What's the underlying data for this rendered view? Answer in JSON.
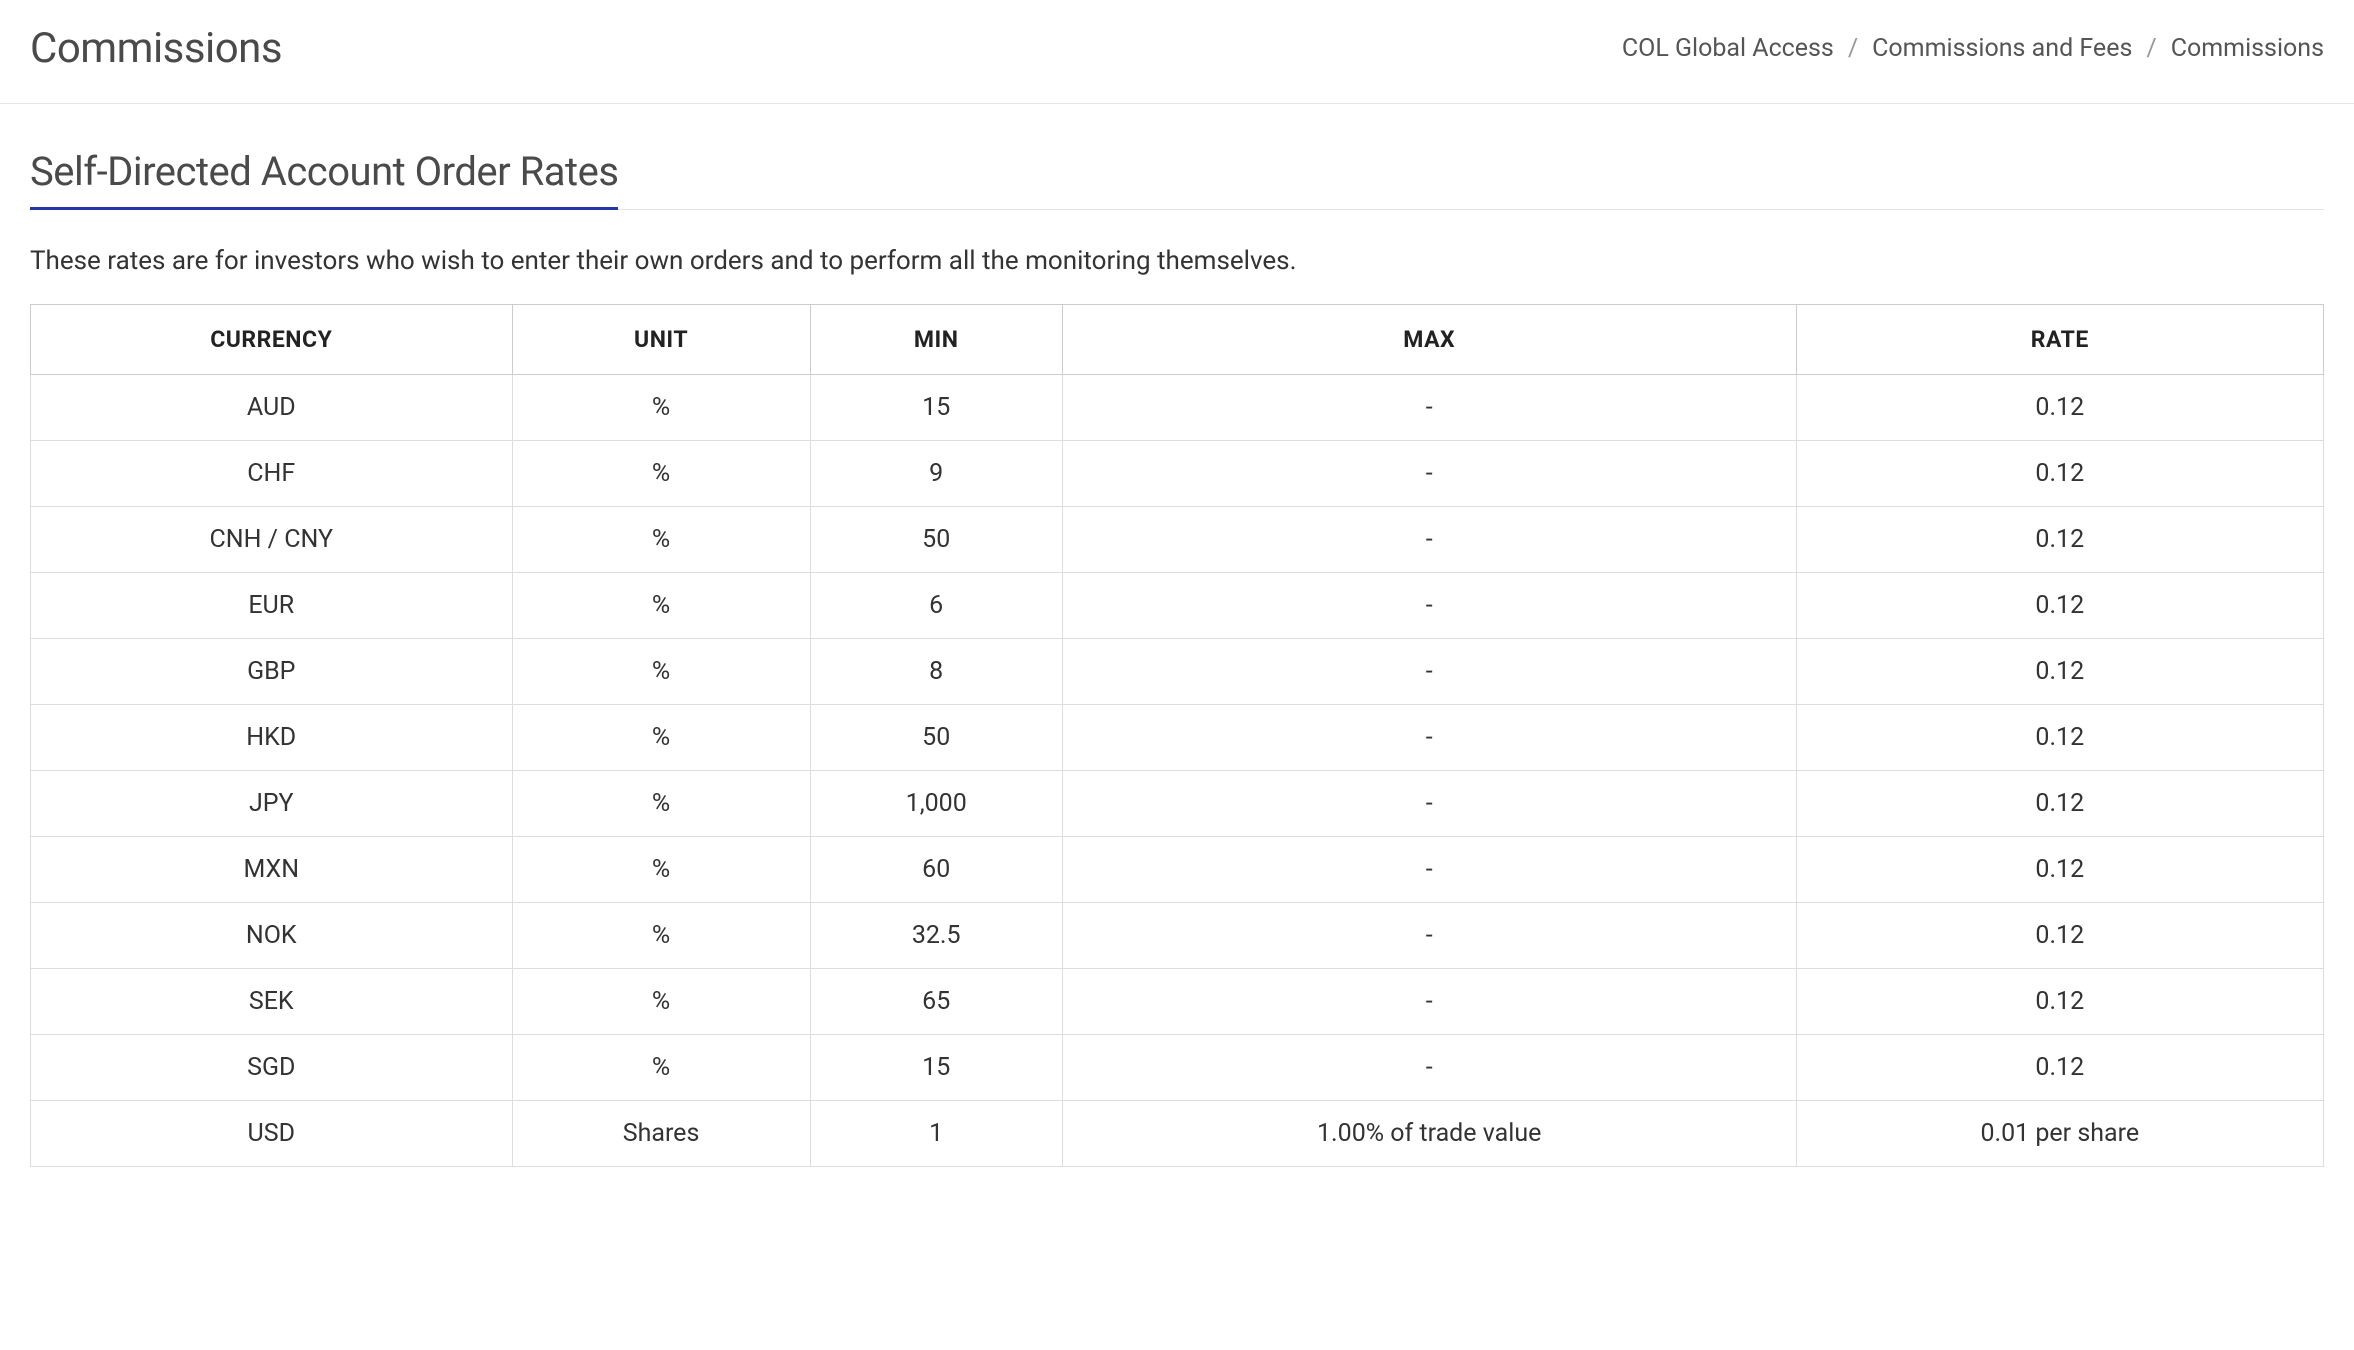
{
  "header": {
    "title": "Commissions",
    "breadcrumb": {
      "items": [
        {
          "label": "COL Global Access"
        },
        {
          "label": "Commissions and Fees"
        }
      ],
      "current": "Commissions",
      "separator": "/"
    }
  },
  "section": {
    "heading": "Self-Directed Account Order Rates",
    "description": "These rates are for investors who wish to enter their own orders and to perform all the monitoring themselves."
  },
  "table": {
    "columns": [
      "CURRENCY",
      "UNIT",
      "MIN",
      "MAX",
      "RATE"
    ],
    "rows": [
      {
        "currency": "AUD",
        "unit": "%",
        "min": "15",
        "max": "-",
        "rate": "0.12"
      },
      {
        "currency": "CHF",
        "unit": "%",
        "min": "9",
        "max": "-",
        "rate": "0.12"
      },
      {
        "currency": "CNH / CNY",
        "unit": "%",
        "min": "50",
        "max": "-",
        "rate": "0.12"
      },
      {
        "currency": "EUR",
        "unit": "%",
        "min": "6",
        "max": "-",
        "rate": "0.12"
      },
      {
        "currency": "GBP",
        "unit": "%",
        "min": "8",
        "max": "-",
        "rate": "0.12"
      },
      {
        "currency": "HKD",
        "unit": "%",
        "min": "50",
        "max": "-",
        "rate": "0.12"
      },
      {
        "currency": "JPY",
        "unit": "%",
        "min": "1,000",
        "max": "-",
        "rate": "0.12"
      },
      {
        "currency": "MXN",
        "unit": "%",
        "min": "60",
        "max": "-",
        "rate": "0.12"
      },
      {
        "currency": "NOK",
        "unit": "%",
        "min": "32.5",
        "max": "-",
        "rate": "0.12"
      },
      {
        "currency": "SEK",
        "unit": "%",
        "min": "65",
        "max": "-",
        "rate": "0.12"
      },
      {
        "currency": "SGD",
        "unit": "%",
        "min": "15",
        "max": "-",
        "rate": "0.12"
      },
      {
        "currency": "USD",
        "unit": "Shares",
        "min": "1",
        "max": "1.00% of trade value",
        "rate": "0.01 per share"
      }
    ]
  }
}
